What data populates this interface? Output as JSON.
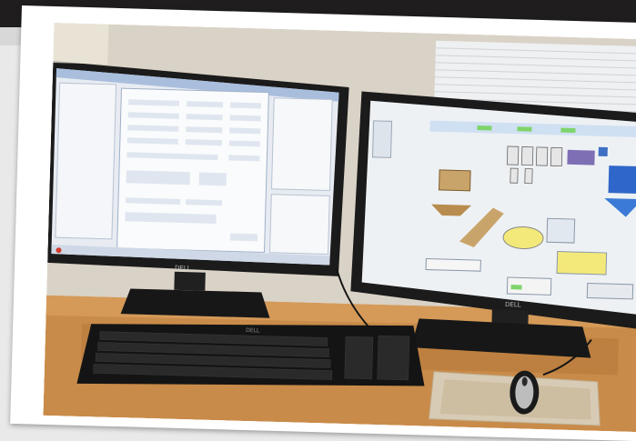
{
  "photo": {
    "left_monitor_brand": "DELL",
    "right_monitor_brand": "DELL",
    "keyboard_brand": "DELL",
    "colors": {
      "wall": "#d9d2c6",
      "desk": "#c98b49",
      "monitor_bezel": "#1b1b1b",
      "screen_bg": "#e8ecf2",
      "window_blue": "#a9bedc",
      "accent_yellow": "#f3e97a",
      "accent_green": "#7fd46b",
      "accent_tan": "#c9a46a"
    },
    "icons": [
      "mouse-icon",
      "mouse-pad-icon"
    ]
  }
}
